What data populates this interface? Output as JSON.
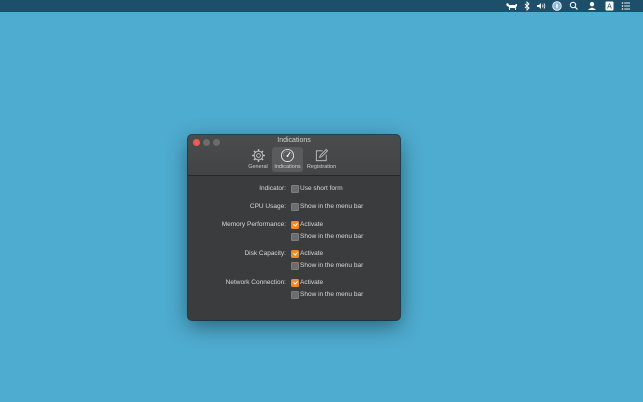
{
  "menubar": {
    "icons": [
      "dog-icon",
      "bluetooth-icon",
      "volume-icon",
      "compass-icon",
      "search-icon",
      "user-icon",
      "input-source-icon",
      "notification-center-icon"
    ],
    "input_source_letter": "A"
  },
  "window": {
    "title": "Indications",
    "toolbar": [
      {
        "label": "General",
        "icon": "gear-icon",
        "selected": false
      },
      {
        "label": "Indications",
        "icon": "gauge-icon",
        "selected": true
      },
      {
        "label": "Registration",
        "icon": "pencil-icon",
        "selected": false
      }
    ],
    "rows": [
      {
        "label": "Indicator:",
        "options": [
          {
            "text": "Use short form",
            "checked": false
          }
        ]
      },
      {
        "label": "CPU Usage:",
        "options": [
          {
            "text": "Show in the menu bar",
            "checked": false
          }
        ]
      },
      {
        "label": "Memory Performance:",
        "options": [
          {
            "text": "Activate",
            "checked": true
          },
          {
            "text": "Show in the menu bar",
            "checked": false
          }
        ]
      },
      {
        "label": "Disk Capacity:",
        "options": [
          {
            "text": "Activate",
            "checked": true
          },
          {
            "text": "Show in the menu bar",
            "checked": false
          }
        ]
      },
      {
        "label": "Network Connection:",
        "options": [
          {
            "text": "Activate",
            "checked": true
          },
          {
            "text": "Show in the menu bar",
            "checked": false
          }
        ]
      }
    ]
  },
  "colors": {
    "desktop": "#4eacd0",
    "checkbox_accent": "#f08a24",
    "close_button": "#ee5b55"
  }
}
